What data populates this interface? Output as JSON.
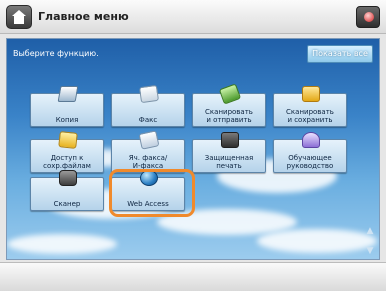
{
  "header": {
    "title": "Главное меню",
    "home_icon": "home-icon",
    "menu_icon": "status-monitor-icon"
  },
  "main": {
    "prompt": "Выберите функцию.",
    "show_all_label": "Показать все",
    "tiles": [
      {
        "label": "Копия",
        "icon": "copy-icon"
      },
      {
        "label": "Факс",
        "icon": "fax-icon"
      },
      {
        "label": "Сканировать\nи отправить",
        "icon": "scan-send-icon"
      },
      {
        "label": "Сканировать\nи сохранить",
        "icon": "scan-save-icon"
      },
      {
        "label": "Доступ к\nсохр.файлам",
        "icon": "stored-files-icon"
      },
      {
        "label": "Яч. факса/\nИ-факса",
        "icon": "fax-inbox-icon"
      },
      {
        "label": "Защищенная\nпечать",
        "icon": "secure-print-icon"
      },
      {
        "label": "Обучающее\nруководство",
        "icon": "training-icon"
      },
      {
        "label": "Сканер",
        "icon": "scanner-icon"
      },
      {
        "label": "Web Access",
        "icon": "web-access-icon"
      }
    ],
    "scroll_up": "▲",
    "scroll_down": "▼"
  },
  "highlight_color": "#f08a2c"
}
